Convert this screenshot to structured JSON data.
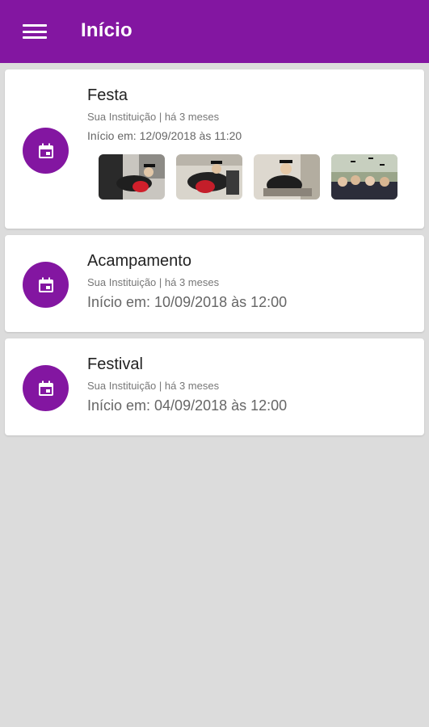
{
  "appbar": {
    "title": "Início",
    "menu_icon": "hamburger-menu-icon",
    "color": "#8316a1"
  },
  "events": [
    {
      "title": "Festa",
      "meta": "Sua Instituição | há 3 meses",
      "start": "Início em: 12/09/2018 às 11:20",
      "icon": "calendar-icon",
      "photos": [
        "graduation-photo-1",
        "graduation-photo-2",
        "graduation-photo-3",
        "graduation-photo-4"
      ]
    },
    {
      "title": "Acampamento",
      "meta": "Sua Instituição | há 3 meses",
      "start": "Início em: 10/09/2018 às 12:00",
      "icon": "calendar-icon"
    },
    {
      "title": "Festival",
      "meta": "Sua Instituição | há 3 meses",
      "start": "Início em: 04/09/2018 às 12:00",
      "icon": "calendar-icon"
    }
  ]
}
